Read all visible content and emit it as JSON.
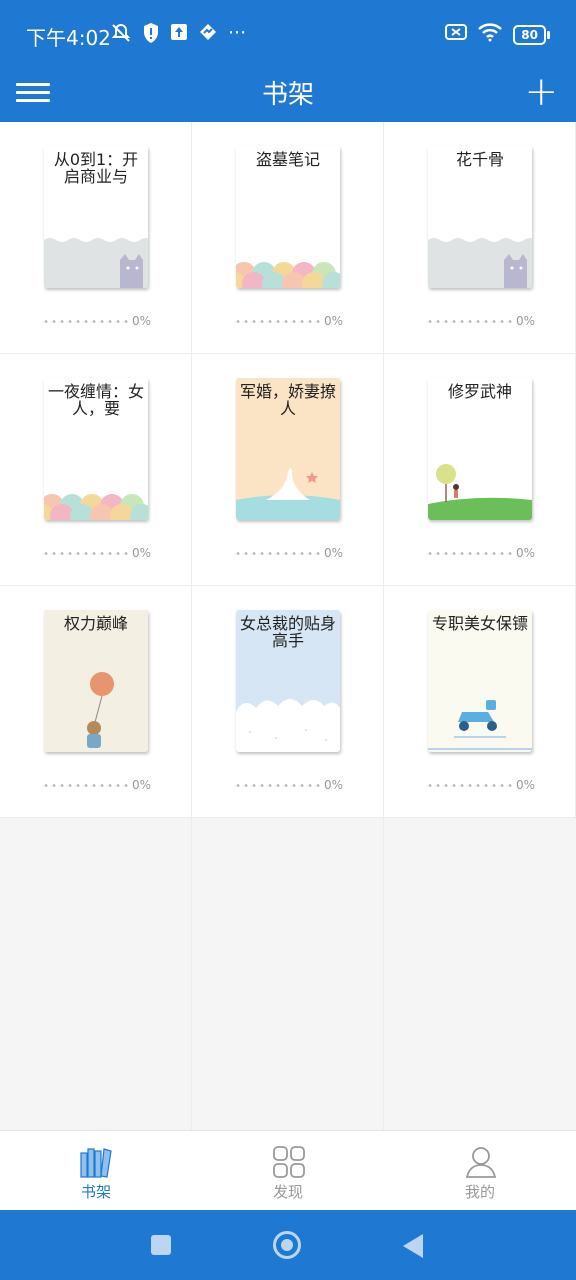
{
  "status": {
    "time": "下午4:02",
    "more": "···",
    "battery": "80"
  },
  "appbar": {
    "title": "书架",
    "add": "+"
  },
  "books": [
    {
      "title": "从0到1：开启商业与",
      "progress": "0%",
      "cover": "cat"
    },
    {
      "title": "盗墓笔记",
      "progress": "0%",
      "cover": "waves"
    },
    {
      "title": "花千骨",
      "progress": "0%",
      "cover": "cat"
    },
    {
      "title": "一夜缠情：女人，要",
      "progress": "0%",
      "cover": "waves"
    },
    {
      "title": "军婚，娇妻撩人",
      "progress": "0%",
      "cover": "bird"
    },
    {
      "title": "修罗武神",
      "progress": "0%",
      "cover": "hill"
    },
    {
      "title": "权力巅峰",
      "progress": "0%",
      "cover": "bear"
    },
    {
      "title": "女总裁的贴身高手",
      "progress": "0%",
      "cover": "cloud"
    },
    {
      "title": "专职美女保镖",
      "progress": "0%",
      "cover": "scooter"
    }
  ],
  "nav": {
    "shelf": "书架",
    "discover": "发现",
    "mine": "我的"
  },
  "colors": {
    "primary": "#1f78d1",
    "inactive": "#999999"
  }
}
